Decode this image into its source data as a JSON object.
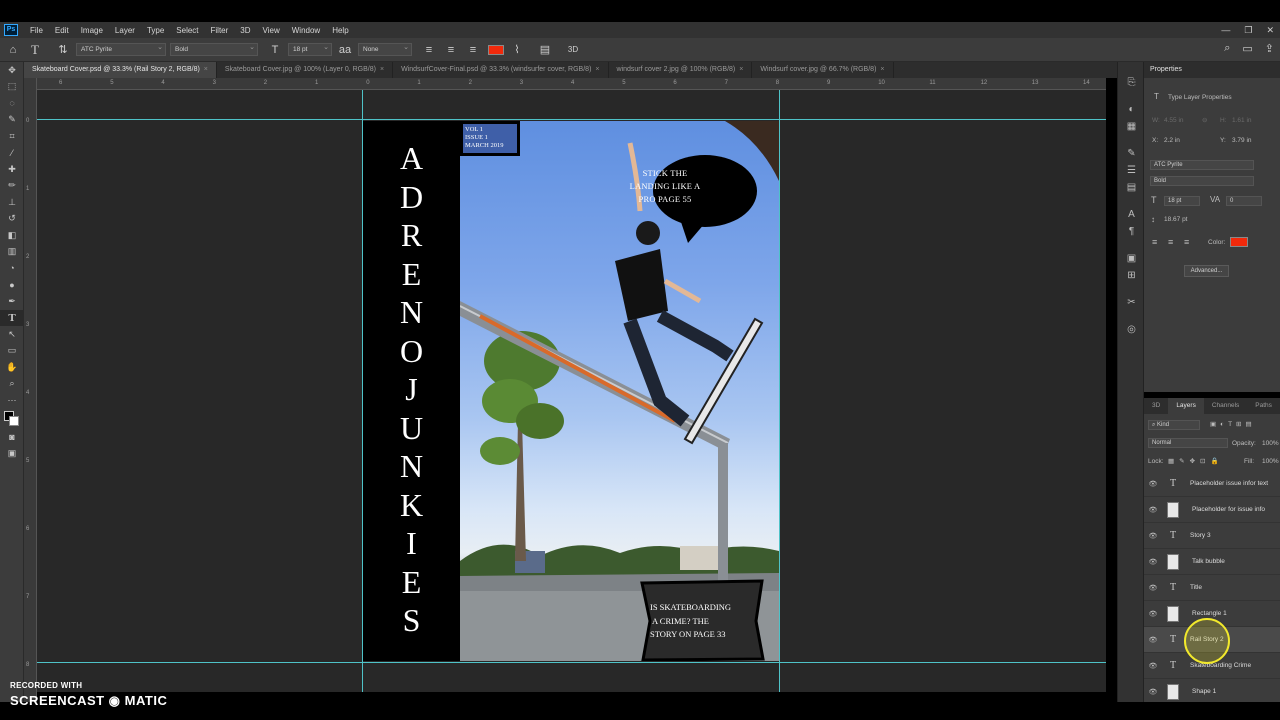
{
  "menubar": {
    "app_icon": "Ps",
    "items": [
      "File",
      "Edit",
      "Image",
      "Layer",
      "Type",
      "Select",
      "Filter",
      "3D",
      "View",
      "Window",
      "Help"
    ],
    "window_controls": [
      "—",
      "❐",
      "✕"
    ]
  },
  "options_bar": {
    "font_family": "ATC Pyrite",
    "font_style": "Bold",
    "font_size": "18 pt",
    "anti_alias": "None",
    "text_color": "#f1290b",
    "three_d": "3D"
  },
  "tabs": [
    {
      "label": "Skateboard Cover.psd @ 33.3% (Rail Story 2, RGB/8)",
      "active": true
    },
    {
      "label": "Skateboard Cover.jpg @ 100% (Layer 0, RGB/8)",
      "active": false
    },
    {
      "label": "WindsurfCover-Final.psd @ 33.3% (windsurfer cover, RGB/8)",
      "active": false
    },
    {
      "label": "windsurf cover 2.jpg @ 100% (RGB/8)",
      "active": false
    },
    {
      "label": "Windsurf cover.jpg @ 66.7% (RGB/8)",
      "active": false
    }
  ],
  "ruler_top": [
    "6",
    "5",
    "4",
    "3",
    "2",
    "1",
    "0",
    "1",
    "2",
    "3",
    "4",
    "5",
    "6",
    "7",
    "8",
    "9",
    "10",
    "11",
    "12",
    "13",
    "14"
  ],
  "ruler_left": [
    "0",
    "1",
    "2",
    "3",
    "4",
    "5",
    "6",
    "7",
    "8"
  ],
  "cover": {
    "title_letters": [
      "A",
      "D",
      "R",
      "E",
      "N",
      "O",
      "J",
      "U",
      "N",
      "K",
      "I",
      "E",
      "S"
    ],
    "issue_lines": [
      "VOL 1",
      "ISSUE 1",
      "MARCH 2019"
    ],
    "bubble_lines": [
      "STICK THE",
      "LANDING LIKE A",
      "PRO PAGE 55"
    ],
    "crime_lines": [
      "IS SKATEBOARDING",
      "A CRIME? THE",
      "STORY ON PAGE 33"
    ]
  },
  "properties": {
    "tab": "Properties",
    "section": "Type Layer Properties",
    "w_label": "W:",
    "w_value": "4.55 in",
    "h_label": "H:",
    "h_value": "1.61 in",
    "x_label": "X:",
    "x_value": "2.2 in",
    "y_label": "Y:",
    "y_value": "3.79 in",
    "font_family": "ATC Pyrite",
    "font_style": "Bold",
    "font_size": "18 pt",
    "tracking": "0",
    "leading": "18.67 pt",
    "color_label": "Color:",
    "advanced": "Advanced..."
  },
  "layers_panel": {
    "tabs": [
      "3D",
      "Layers",
      "Channels",
      "Paths"
    ],
    "active_tab": "Layers",
    "filter": "Kind",
    "blend_mode": "Normal",
    "opacity_label": "Opacity:",
    "opacity": "100%",
    "lock_label": "Lock:",
    "fill_label": "Fill:",
    "fill": "100%",
    "layers": [
      {
        "name": "Placeholder issue infor text",
        "kind": "text",
        "selected": false
      },
      {
        "name": "Placeholder for issue info",
        "kind": "shape",
        "selected": false
      },
      {
        "name": "Story 3",
        "kind": "text",
        "selected": false
      },
      {
        "name": "Talk bubble",
        "kind": "shape",
        "selected": false
      },
      {
        "name": "Title",
        "kind": "text",
        "selected": false
      },
      {
        "name": "Rectangle 1",
        "kind": "shape",
        "selected": false
      },
      {
        "name": "Rail Story 2",
        "kind": "text",
        "selected": true
      },
      {
        "name": "Skateboarding Crime",
        "kind": "text",
        "selected": false
      },
      {
        "name": "Shape 1",
        "kind": "shape",
        "selected": false
      }
    ]
  },
  "watermark": {
    "line1": "RECORDED WITH",
    "line2": "SCREENCAST ◉ MATIC"
  }
}
